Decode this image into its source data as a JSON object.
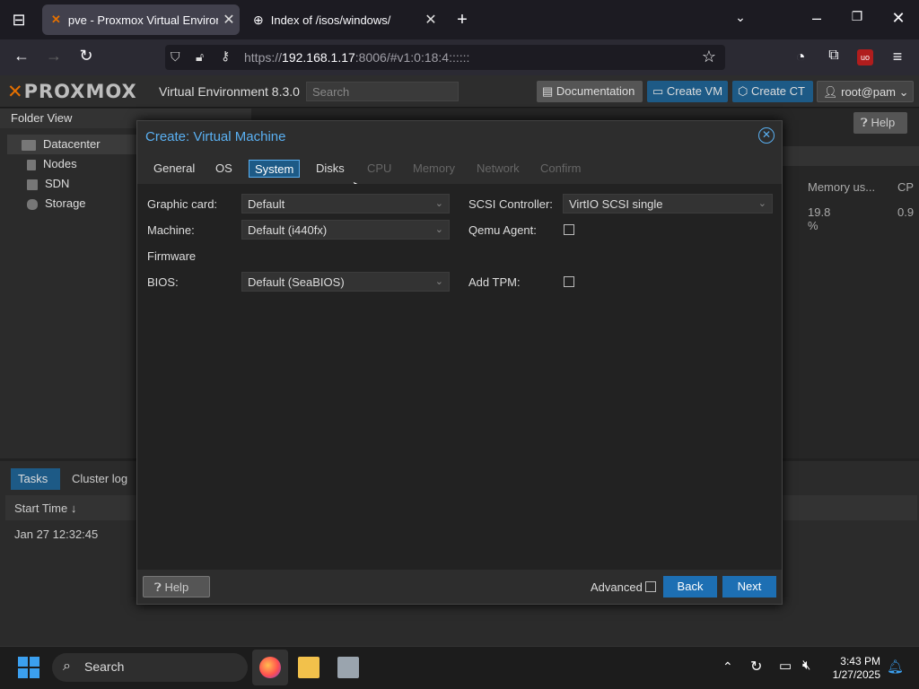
{
  "browser": {
    "tabs": [
      {
        "title": "pve - Proxmox Virtual Environment",
        "active": true
      },
      {
        "title": "Index of /isos/windows/",
        "active": false
      }
    ],
    "url_prefix": "https://",
    "url_host": "192.168.1.17",
    "url_rest": ":8006/#v1:0:18:4::::::"
  },
  "pve": {
    "logo": "PROXMOX",
    "subtitle": "Virtual Environment 8.3.0",
    "search_placeholder": "Search",
    "buttons": {
      "docs": "Documentation",
      "create_vm": "Create VM",
      "create_ct": "Create CT",
      "user": "root@pam"
    },
    "folder_view": "Folder View",
    "tree": [
      "Datacenter",
      "Nodes",
      "SDN",
      "Storage"
    ],
    "help": "Help",
    "mem_col": "Memory us...",
    "cpu_col": "CP",
    "mem_val": "19.8 %",
    "cpu_val": "0.9",
    "bottom_tabs": [
      "Tasks",
      "Cluster log"
    ],
    "start_time_hdr": "Start Time ↓",
    "task_row_time": "Jan 27 12:32:45"
  },
  "modal": {
    "title": "Create: Virtual Machine",
    "tabs": [
      {
        "label": "General",
        "state": "normal"
      },
      {
        "label": "OS",
        "state": "normal"
      },
      {
        "label": "System",
        "state": "active"
      },
      {
        "label": "Disks",
        "state": "normal"
      },
      {
        "label": "CPU",
        "state": "disabled"
      },
      {
        "label": "Memory",
        "state": "disabled"
      },
      {
        "label": "Network",
        "state": "disabled"
      },
      {
        "label": "Confirm",
        "state": "disabled"
      }
    ],
    "fields": {
      "graphic_card_label": "Graphic card:",
      "graphic_card_value": "Default",
      "machine_label": "Machine:",
      "machine_value": "Default (i440fx)",
      "firmware_label": "Firmware",
      "bios_label": "BIOS:",
      "bios_value": "Default (SeaBIOS)",
      "scsi_label": "SCSI Controller:",
      "scsi_value": "VirtIO SCSI single",
      "qemu_label": "Qemu Agent:",
      "tpm_label": "Add TPM:"
    },
    "help": "Help",
    "advanced": "Advanced",
    "back": "Back",
    "next": "Next"
  },
  "taskbar": {
    "search": "Search",
    "time": "3:43 PM",
    "date": "1/27/2025"
  },
  "colors": {
    "accent": "#1d6fb3",
    "title_blue": "#5ab0f2",
    "proxmox_orange": "#e57000"
  }
}
